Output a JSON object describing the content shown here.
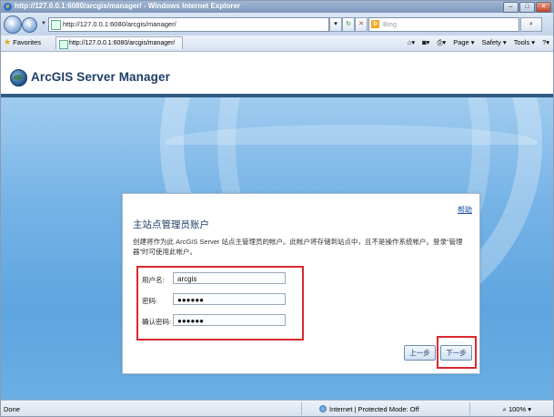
{
  "window": {
    "title": "http://127.0.0.1:6080/arcgis/manager/ - Windows Internet Explorer",
    "controls": {
      "minimize": "–",
      "maximize": "□",
      "close": "✕"
    }
  },
  "toolbar": {
    "address": "http://127.0.0.1:6080/arcgis/manager/",
    "search_placeholder": "Bing",
    "back_icon": "back-arrow-icon",
    "forward_icon": "forward-arrow-icon"
  },
  "favorites_bar": {
    "favorites_label": "Favorites",
    "tab_title": "http://127.0.0.1:6080/arcgis/manager/",
    "tools": {
      "page": "Page ▾",
      "safety": "Safety ▾",
      "tools": "Tools ▾",
      "help": "?▾"
    }
  },
  "app": {
    "title": "ArcGIS Server Manager"
  },
  "dialog": {
    "help_link": "帮助",
    "heading": "主站点管理员账户",
    "description": "创建将作为此 ArcGIS Server 站点主管理员的帐户。此帐户将存储到站点中，且不是操作系统帐户。登录“管理器”时可使用此帐户。",
    "fields": [
      {
        "label": "用户名:",
        "value": "arcgis"
      },
      {
        "label": "密码:",
        "value": "●●●●●●"
      },
      {
        "label": "确认密码:",
        "value": "●●●●●●"
      }
    ],
    "back_button": "上一步",
    "next_button": "下一步"
  },
  "statusbar": {
    "status": "Done",
    "zone": "Internet | Protected Mode: Off",
    "zoom": "100%"
  }
}
